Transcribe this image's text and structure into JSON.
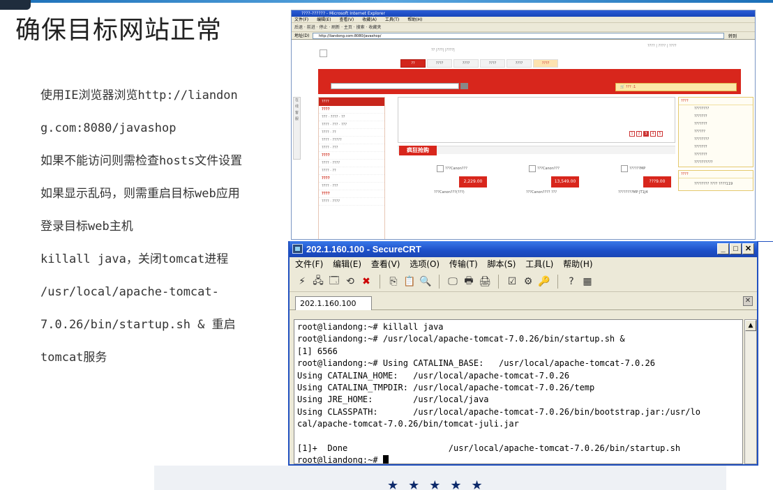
{
  "slide": {
    "title": "确保目标网站正常",
    "notes": [
      "使用IE浏览器浏览http://liandon",
      "g.com:8080/javashop",
      "如果不能访问则需检查hosts文件设置",
      "如果显示乱码，则需重启目标web应用",
      "登录目标web主机",
      "killall java，关闭tomcat进程",
      "/usr/local/apache-tomcat-",
      "7.0.26/bin/startup.sh & 重启",
      "tomcat服务"
    ]
  },
  "ie": {
    "title": "????-?????? - Microsoft Internet Explorer",
    "menu": [
      "文件(F)",
      "编辑(E)",
      "查看(V)",
      "收藏(A)",
      "工具(T)",
      "帮助(H)"
    ],
    "toolbar": "后退 · 前进 · 停止 · 刷新 · 主页 · 搜索 · 收藏夹",
    "address_label": "地址(D)",
    "address": "http://liandong.com:8080/javashop/",
    "go": "转到",
    "page": {
      "topline": "?? |???| |????|",
      "topright": "???? | ???? | ????",
      "nav": [
        "??",
        "????",
        "????",
        "????",
        "????",
        "????"
      ],
      "cart": "??? :1",
      "search_btn": "??",
      "side_strip": "在线客服",
      "cat_head": "????",
      "categories": [
        "????",
        "??? · ???? · ??",
        "???? · ??? · ???",
        "???? · ??",
        "???? · ?????",
        "???? · ???",
        "????",
        "???? · ????",
        "???? · ??",
        "????",
        "???? · ???",
        "????",
        "???? · ????"
      ],
      "pager": [
        "1",
        "2",
        "3",
        "4",
        "5"
      ],
      "flash_tag": "疯狂抢购",
      "products": [
        {
          "name": "???Canon???",
          "price": "2,229.00",
          "desc": "???Canon???(???)"
        },
        {
          "name": "???Canon???",
          "price": "13,549.00",
          "desc": "???Canon???? ???"
        },
        {
          "name": "??????MP",
          "price": "???9.00",
          "desc": "????????MP JT1J4"
        }
      ],
      "right_head1": "????",
      "right_items": [
        "????????",
        "???????",
        "???????",
        "??????",
        "????????",
        "???????",
        "???????",
        "??????????"
      ],
      "right_head2": "????",
      "right_promo": "???????? ???? ????119"
    }
  },
  "crt": {
    "title": "202.1.160.100 - SecureCRT",
    "menu": [
      "文件(F)",
      "编辑(E)",
      "查看(V)",
      "选项(O)",
      "传输(T)",
      "脚本(S)",
      "工具(L)",
      "帮助(H)"
    ],
    "tab": "202.1.160.100",
    "terminal": [
      "root@liandong:~# killall java",
      "root@liandong:~# /usr/local/apache-tomcat-7.0.26/bin/startup.sh &",
      "[1] 6566",
      "root@liandong:~# Using CATALINA_BASE:   /usr/local/apache-tomcat-7.0.26",
      "Using CATALINA_HOME:   /usr/local/apache-tomcat-7.0.26",
      "Using CATALINA_TMPDIR: /usr/local/apache-tomcat-7.0.26/temp",
      "Using JRE_HOME:        /usr/local/java",
      "Using CLASSPATH:       /usr/local/apache-tomcat-7.0.26/bin/bootstrap.jar:/usr/lo",
      "cal/apache-tomcat-7.0.26/bin/tomcat-juli.jar",
      "",
      "[1]+  Done                    /usr/local/apache-tomcat-7.0.26/bin/startup.sh",
      "root@liandong:~# "
    ]
  },
  "decor": {
    "stars": "★★★★★"
  },
  "colors": {
    "site_red": "#d8261c",
    "crt_title_blue": "#1c4fc8",
    "star_navy": "#0d2a6b"
  }
}
